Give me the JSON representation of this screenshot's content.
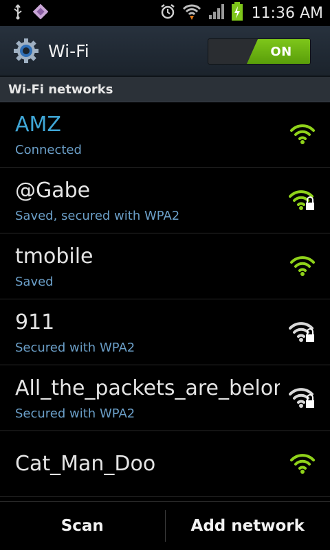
{
  "status_bar": {
    "time": "11:36 AM"
  },
  "title_bar": {
    "title": "Wi-Fi",
    "toggle_label": "ON"
  },
  "section_header": "Wi-Fi networks",
  "networks": [
    {
      "name": "AMZ",
      "status": "Connected",
      "signal_color": "#8fd21a",
      "secured": false,
      "icon": "wifi-signal-icon"
    },
    {
      "name": "@Gabe",
      "status": "Saved, secured with WPA2",
      "signal_color": "#8fd21a",
      "secured": true,
      "icon": "wifi-signal-lock-icon"
    },
    {
      "name": "tmobile",
      "status": "Saved",
      "signal_color": "#8fd21a",
      "secured": false,
      "icon": "wifi-signal-icon"
    },
    {
      "name": "911",
      "status": "Secured with WPA2",
      "signal_color": "#d8d8d8",
      "secured": true,
      "icon": "wifi-signal-lock-icon"
    },
    {
      "name": "All_the_packets_are_belon",
      "status": "Secured with WPA2",
      "signal_color": "#d8d8d8",
      "secured": true,
      "icon": "wifi-signal-lock-icon"
    },
    {
      "name": "Cat_Man_Doo",
      "status": "",
      "signal_color": "#8fd21a",
      "secured": false,
      "icon": "wifi-signal-icon"
    }
  ],
  "bottom_bar": {
    "scan_label": "Scan",
    "add_network_label": "Add network"
  }
}
